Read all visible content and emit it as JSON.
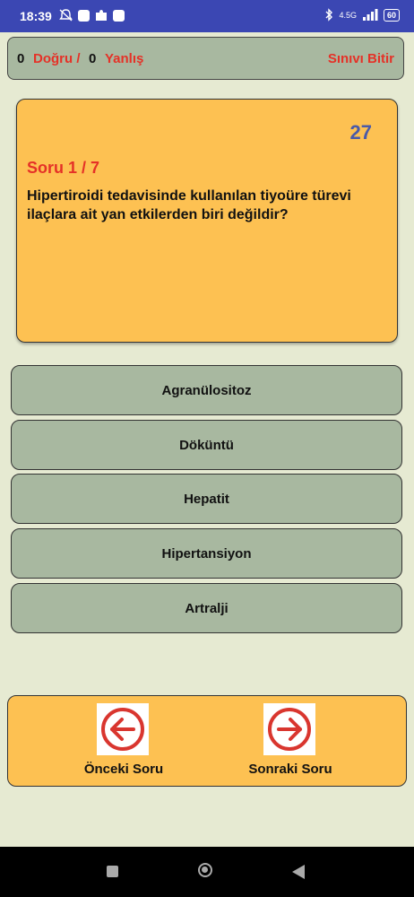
{
  "status": {
    "time": "18:39",
    "network": "4.5G",
    "battery": "60"
  },
  "score": {
    "correct_count": "0",
    "correct_label": "Doğru /",
    "wrong_count": "0",
    "wrong_label": "Yanlış",
    "finish_label": "Sınıvı Bitir"
  },
  "question": {
    "timer": "27",
    "number": "Soru  1  /  7",
    "text": "Hipertiroidi tedavisinde kullanılan tiyoüre türevi ilaçlara ait yan etkilerden biri değildir?"
  },
  "answers": [
    "Agranülositoz",
    "Döküntü",
    "Hepatit",
    "Hipertansiyon",
    "Artralji"
  ],
  "nav": {
    "prev_label": "Önceki Soru",
    "next_label": "Sonraki Soru"
  },
  "colors": {
    "accent_red": "#e53127",
    "card_orange": "#fdc152",
    "answer_green": "#a8b8a0",
    "status_blue": "#3b47b3"
  },
  "icons": {
    "prev": "arrow-left-circle-icon",
    "next": "arrow-right-circle-icon"
  }
}
